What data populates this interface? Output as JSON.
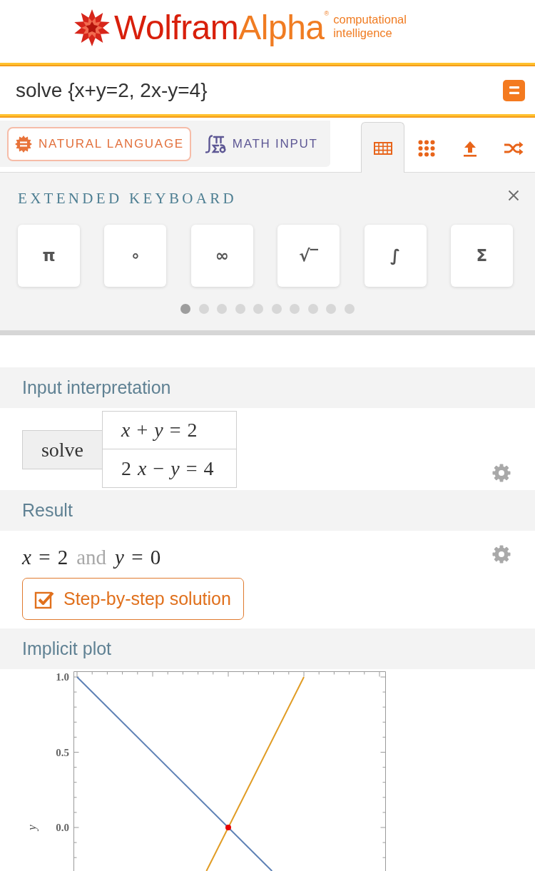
{
  "logo": {
    "wordmark_first": "Wolfram",
    "wordmark_second": "Alpha",
    "registered_mark": "®",
    "tagline": [
      "computational",
      "intelligence"
    ]
  },
  "query": {
    "value": "solve {x+y=2, 2x-y=4}"
  },
  "input_modes": [
    {
      "kind": "natural",
      "label": "NATURAL LANGUAGE",
      "selected": true
    },
    {
      "kind": "math",
      "label": "MATH INPUT",
      "selected": false
    }
  ],
  "toolbar": [
    {
      "kind": "keyboard",
      "selected": true
    },
    {
      "kind": "grid",
      "selected": false
    },
    {
      "kind": "upload",
      "selected": false
    },
    {
      "kind": "random",
      "selected": false
    }
  ],
  "keyboard": {
    "title": "EXTENDED KEYBOARD",
    "keys": [
      "π",
      "∘",
      "∞",
      "√‾",
      "∫",
      "Σ"
    ],
    "pages": [
      {
        "selected": true
      },
      {
        "selected": false
      },
      {
        "selected": false
      },
      {
        "selected": false
      },
      {
        "selected": false
      },
      {
        "selected": false
      },
      {
        "selected": false
      },
      {
        "selected": false
      },
      {
        "selected": false
      },
      {
        "selected": false
      }
    ]
  },
  "pods": [
    {
      "kind": "interpretation",
      "title": "Input interpretation",
      "settings": true,
      "function": "solve",
      "equations": [
        "*x* + *y* = 2",
        "2 *x* − *y* = 4"
      ]
    },
    {
      "kind": "result",
      "title": "Result",
      "settings": true,
      "result_parts": [
        {
          "kind": "math",
          "text": "*x* = 2"
        },
        {
          "kind": "word",
          "text": "and"
        },
        {
          "kind": "math",
          "text": "*y* = 0"
        }
      ],
      "button": {
        "label": "Step-by-step solution"
      }
    },
    {
      "kind": "plot",
      "title": "Implicit plot",
      "settings": false,
      "plot": {
        "y_axis_label": "y",
        "y_tick_labels": [
          "1.0",
          "0.5",
          "0.0"
        ]
      }
    }
  ]
}
